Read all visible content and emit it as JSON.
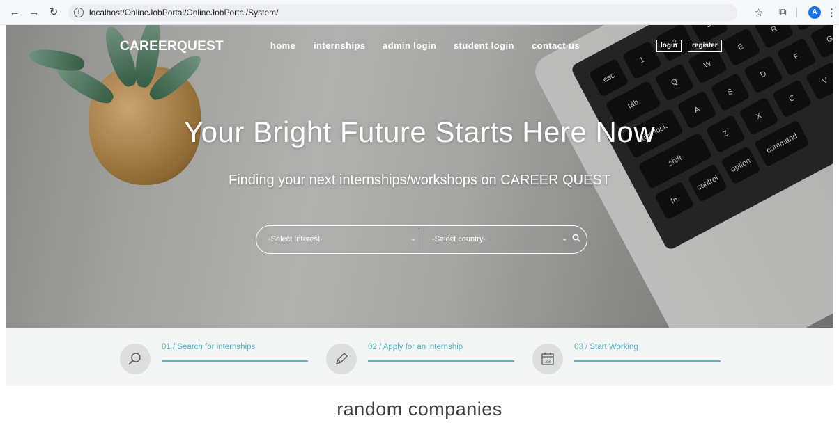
{
  "browser": {
    "url": "localhost/OnlineJobPortal/OnlineJobPortal/System/",
    "avatar_letter": "A"
  },
  "nav": {
    "brand": "CAREERQUEST",
    "items": [
      {
        "label": "home"
      },
      {
        "label": "internships"
      },
      {
        "label": "admin login"
      },
      {
        "label": "student login"
      },
      {
        "label": "contact us"
      }
    ],
    "login_label": "login",
    "register_label": "register"
  },
  "hero": {
    "headline": "Your Bright Future Starts Here Now",
    "subline": "Finding your next internships/workshops on CAREER QUEST",
    "interest_select": "-Select Interest-",
    "country_select": "-Select country-"
  },
  "steps": [
    {
      "label": "01 / Search for internships",
      "icon": "magnifier-icon"
    },
    {
      "label": "02 / Apply for an internship",
      "icon": "pencil-icon"
    },
    {
      "label": "03 / Start Working",
      "icon": "calendar-icon",
      "calendar_day": "23"
    }
  ],
  "section": {
    "title": "random companies"
  },
  "colors": {
    "accent": "#4fb7c8",
    "hero_text": "#ffffff"
  }
}
